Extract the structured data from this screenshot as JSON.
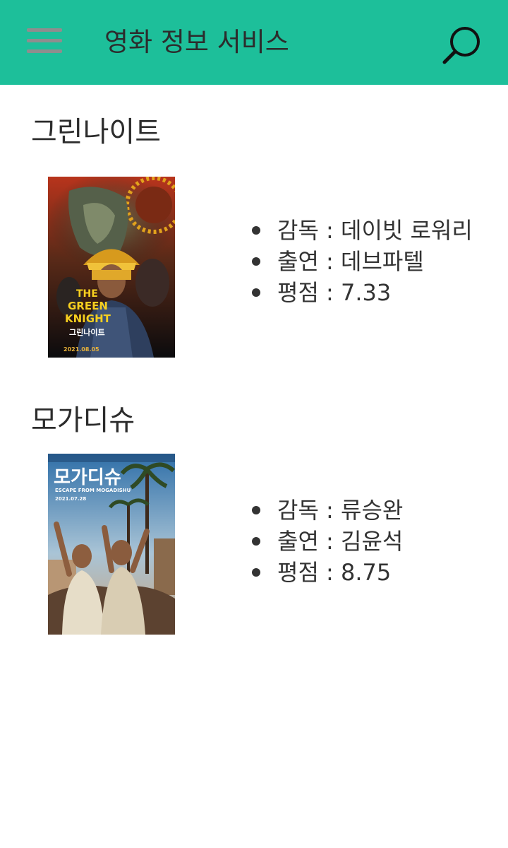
{
  "header": {
    "title": "영화 정보 서비스",
    "menu_icon": "hamburger-menu-icon",
    "search_icon": "search-icon",
    "background_color": "#1dbf9a"
  },
  "movies": [
    {
      "title": "그린나이트",
      "poster": {
        "title_line1": "THE",
        "title_line2": "GREEN",
        "title_line3": "KNIGHT",
        "korean_title": "그린나이트",
        "date": "2021.08.05"
      },
      "info": [
        {
          "label": "감독",
          "value": "데이빗 로워리",
          "text": "감독 : 데이빗 로워리"
        },
        {
          "label": "출연",
          "value": "데브파텔",
          "text": "출연 : 데브파텔"
        },
        {
          "label": "평점",
          "value": "7.33",
          "text": "평점 : 7.33"
        }
      ]
    },
    {
      "title": "모가디슈",
      "poster": {
        "korean_title": "모가디슈",
        "subtitle": "ESCAPE FROM MOGADISHU",
        "date": "2021.07.28"
      },
      "info": [
        {
          "label": "감독",
          "value": "류승완",
          "text": "감독 : 류승완"
        },
        {
          "label": "출연",
          "value": "김윤석",
          "text": "출연 : 김윤석"
        },
        {
          "label": "평점",
          "value": "8.75",
          "text": "평점 : 8.75"
        }
      ]
    }
  ]
}
